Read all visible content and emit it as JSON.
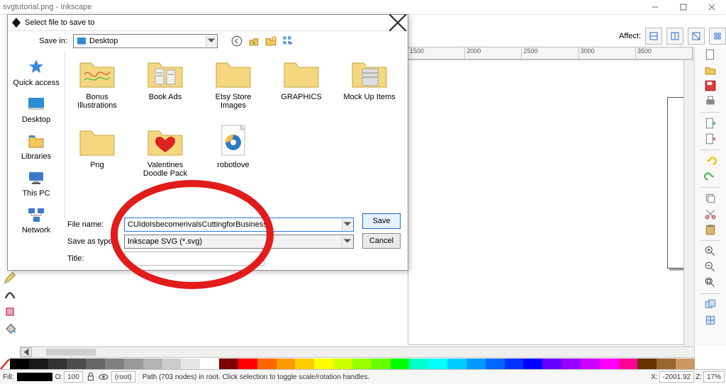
{
  "app": {
    "title": "svgtutorial.png - Inkscape",
    "affect_label": "Affect:"
  },
  "ruler": {
    "ticks": [
      "1500",
      "2000",
      "2500",
      "3000",
      "3500"
    ]
  },
  "status": {
    "fill_label": "Fill:",
    "o_label": "O:",
    "o_value": "100",
    "layer": "(root)",
    "path_info": "Path (703 nodes) in root. Click selection to toggle scale/rotation handles.",
    "x_label": "X:",
    "x_value": "-2001.92",
    "z_label": "Z:",
    "z_value": "17%"
  },
  "palette": [
    "#000000",
    "#1a1a1a",
    "#333333",
    "#4d4d4d",
    "#666666",
    "#808080",
    "#999999",
    "#b3b3b3",
    "#cccccc",
    "#e6e6e6",
    "#ffffff",
    "#800000",
    "#ff0000",
    "#ff6600",
    "#ff9900",
    "#ffcc00",
    "#ffff00",
    "#ccff00",
    "#99ff00",
    "#66ff00",
    "#00ff00",
    "#00ffcc",
    "#00ffff",
    "#00ccff",
    "#0099ff",
    "#0066ff",
    "#0033ff",
    "#0000ff",
    "#6600ff",
    "#9900ff",
    "#cc00ff",
    "#ff00ff",
    "#ff0099",
    "#663300",
    "#996633",
    "#cc9966"
  ],
  "dialog": {
    "title": "Select file to save to",
    "save_in_label": "Save in:",
    "save_in_value": "Desktop",
    "places": [
      {
        "name": "Quick access"
      },
      {
        "name": "Desktop"
      },
      {
        "name": "Libraries"
      },
      {
        "name": "This PC"
      },
      {
        "name": "Network"
      }
    ],
    "files": [
      {
        "name": "Bonus Illustrations",
        "type": "folder-art"
      },
      {
        "name": "Book Ads",
        "type": "folder-doc"
      },
      {
        "name": "Etsy Store Images",
        "type": "folder"
      },
      {
        "name": "GRAPHICS",
        "type": "folder"
      },
      {
        "name": "Mock Up Items",
        "type": "folder-art2"
      },
      {
        "name": "Png",
        "type": "folder"
      },
      {
        "name": "Valentines Doodle Pack",
        "type": "folder-heart"
      },
      {
        "name": "robotlove",
        "type": "file-ie"
      }
    ],
    "file_name_label": "File name:",
    "file_name_value": "CUIdoIsbecomerivalsCuttingforBusiness",
    "save_type_label": "Save as type:",
    "save_type_value": "Inkscape SVG (*.svg)",
    "title_label": "Title:",
    "title_value": "",
    "save_button": "Save",
    "cancel_button": "Cancel"
  }
}
